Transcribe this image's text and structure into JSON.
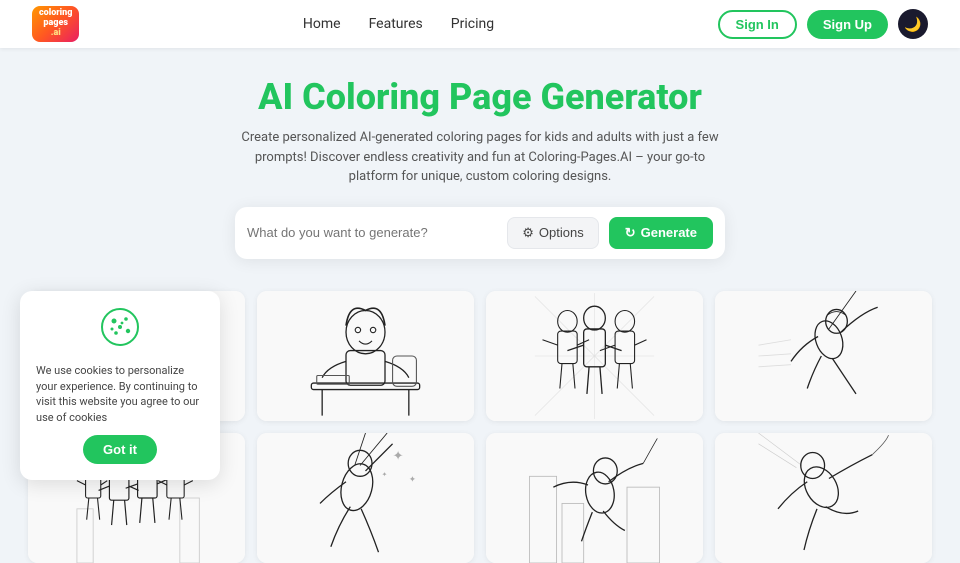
{
  "navbar": {
    "logo_line1": "coloring",
    "logo_line2": "pages",
    "logo_suffix": ".ai",
    "links": [
      "Home",
      "Features",
      "Pricing"
    ],
    "signin_label": "Sign In",
    "signup_label": "Sign Up",
    "dark_toggle_icon": "🌙"
  },
  "hero": {
    "title": "AI Coloring Page Generator",
    "subtitle": "Create personalized AI-generated coloring pages for kids and adults with just a few prompts! Discover endless creativity and fun at Coloring-Pages.AI – your go-to platform for unique, custom coloring designs.",
    "search_placeholder": "What do you want to generate?",
    "options_label": "Options",
    "generate_label": "Generate"
  },
  "cookie": {
    "text": "We use cookies to personalize your experience. By continuing to visit this website you agree to our use of cookies",
    "button_label": "Got it"
  },
  "gallery": {
    "rows": 2,
    "cols": 4
  }
}
